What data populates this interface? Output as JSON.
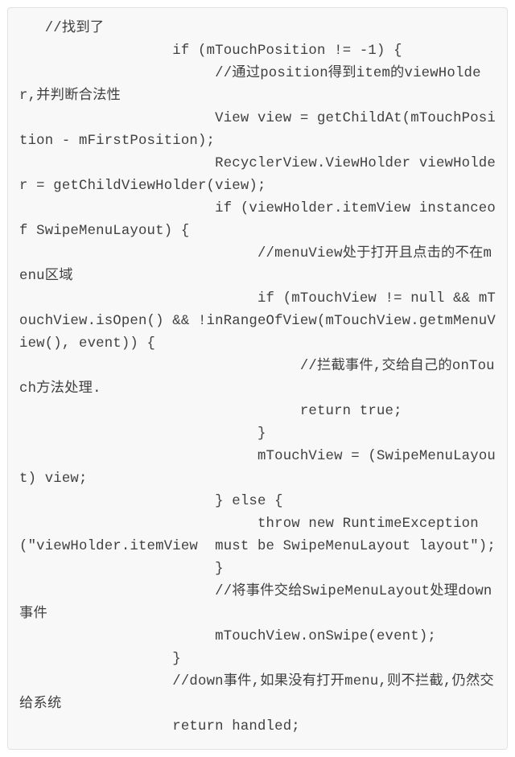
{
  "code": {
    "l01": "   //找到了",
    "l02": "                  if (mTouchPosition != -1) {",
    "l03": "                       //通过position得到item的viewHolder,并判断合法性",
    "l04": "                       View view = getChildAt(mTouchPosition - mFirstPosition);",
    "l05": "                       RecyclerView.ViewHolder viewHolder = getChildViewHolder(view);",
    "l06": "                       if (viewHolder.itemView instanceof SwipeMenuLayout) {",
    "l07": "                            //menuView处于打开且点击的不在menu区域",
    "l08": "                            if (mTouchView != null && mTouchView.isOpen() && !inRangeOfView(mTouchView.getmMenuView(), event)) {",
    "l09": "                                 //拦截事件,交给自己的onTouch方法处理.",
    "l10": "                                 return true;",
    "l11": "                            }",
    "l12": "                            mTouchView = (SwipeMenuLayout) view;",
    "l13": "                       } else {",
    "l14": "                            throw new RuntimeException(\"viewHolder.itemView  must be SwipeMenuLayout layout\");",
    "l15": "                       }",
    "l16": "                       //将事件交给SwipeMenuLayout处理down事件",
    "l17": "                       mTouchView.onSwipe(event);",
    "l18": "                  }",
    "l19": "                  //down事件,如果没有打开menu,则不拦截,仍然交给系统",
    "l20": "                  return handled;"
  }
}
